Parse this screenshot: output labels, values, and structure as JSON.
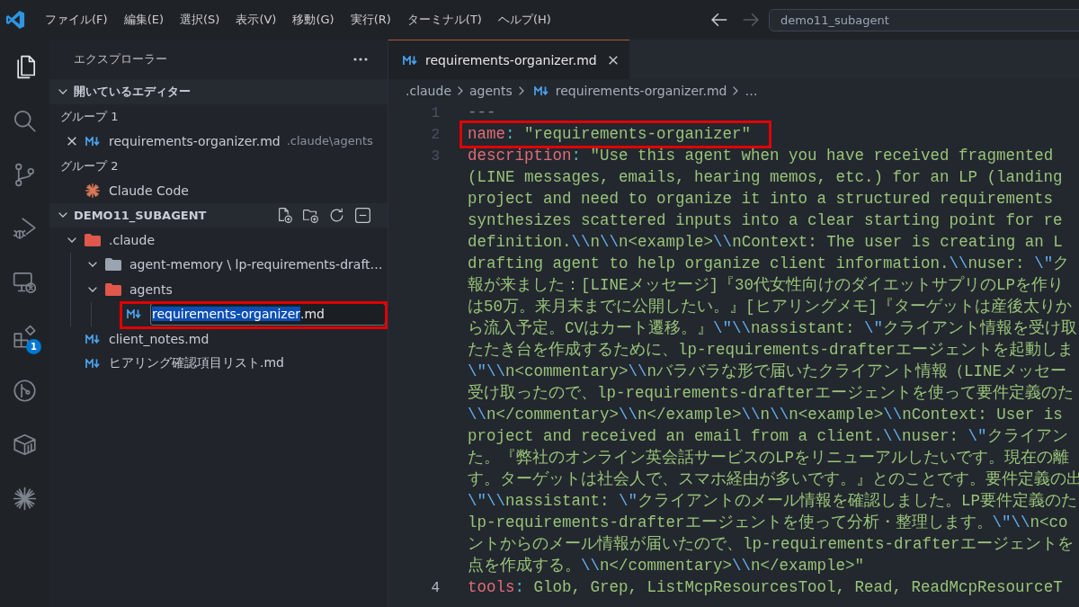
{
  "title_bar": {
    "menus": [
      "ファイル(F)",
      "編集(E)",
      "選択(S)",
      "表示(V)",
      "移動(G)",
      "実行(R)",
      "ターミナル(T)",
      "ヘルプ(H)"
    ],
    "nav": [
      {
        "kind": "back",
        "disabled": false
      },
      {
        "kind": "forward",
        "disabled": true
      }
    ],
    "command_center": {
      "label": "demo11_subagent"
    }
  },
  "activity_bar": [
    {
      "kind": "explorer",
      "selected": true
    },
    {
      "kind": "search",
      "selected": false
    },
    {
      "kind": "source_control",
      "selected": false
    },
    {
      "kind": "run_debug",
      "selected": false
    },
    {
      "kind": "remote",
      "selected": false
    },
    {
      "kind": "extensions",
      "selected": false,
      "badge": "1"
    },
    {
      "kind": "git_graph",
      "selected": false
    },
    {
      "kind": "containers",
      "selected": false
    },
    {
      "kind": "claude",
      "selected": false
    }
  ],
  "sidebar": {
    "title": "エクスプローラー",
    "open_editors": {
      "title": "開いているエディター",
      "expanded": true,
      "groups": [
        {
          "label": "グループ 1",
          "items": [
            {
              "kind": "markdown",
              "name": "requirements-organizer.md",
              "description": ".claude\\agents",
              "selected": true
            }
          ]
        },
        {
          "label": "グループ 2",
          "items": [
            {
              "kind": "claude",
              "name": "Claude Code",
              "selected": false
            }
          ]
        }
      ]
    },
    "workspace": {
      "title": "DEMO11_SUBAGENT",
      "expanded": true,
      "actions": [
        {
          "kind": "new_file"
        },
        {
          "kind": "new_folder"
        },
        {
          "kind": "refresh"
        },
        {
          "kind": "collapse_all"
        }
      ],
      "tree": [
        {
          "kind": "folder",
          "name": ".claude",
          "color": "#e0574b",
          "expanded": true,
          "highlighted": false,
          "children": [
            {
              "kind": "folder",
              "name": "agent-memory \\ lp-requirements-draft…",
              "color": "#9aa4b0",
              "expanded": true,
              "highlighted": false
            },
            {
              "kind": "folder",
              "name": "agents",
              "color": "#e0574b",
              "expanded": true,
              "highlighted": false,
              "children": [
                {
                  "kind": "markdown",
                  "name": "requirements-organizer",
                  "ext": ".md",
                  "editing": true,
                  "highlighted": true
                }
              ]
            }
          ]
        },
        {
          "kind": "markdown",
          "name": "client_notes",
          "ext": ".md",
          "editing": false,
          "highlighted": false
        },
        {
          "kind": "markdown",
          "name": "ヒアリング確認項目リスト",
          "ext": ".md",
          "editing": false,
          "highlighted": false
        }
      ]
    }
  },
  "editor": {
    "tabs": [
      {
        "label": "requirements-organizer.md",
        "selected": true
      }
    ],
    "breadcrumb": [
      {
        "kind": "folder",
        "label": ".claude"
      },
      {
        "kind": "folder",
        "label": "agents"
      },
      {
        "kind": "markdown",
        "label": "requirements-organizer.md"
      },
      {
        "kind": "outline",
        "label": "…"
      }
    ],
    "lines": [
      {
        "number": "1",
        "current": false,
        "highlighted": false,
        "rows": [
          {
            "tokens": [
              {
                "kind": "marker",
                "text": "---"
              }
            ]
          }
        ]
      },
      {
        "number": "2",
        "current": false,
        "highlighted": true,
        "rows": [
          {
            "tokens": [
              {
                "kind": "key",
                "text": "name"
              },
              {
                "kind": "colon",
                "text": ":"
              },
              {
                "kind": "string",
                "text": " \"requirements-organizer\""
              }
            ]
          }
        ]
      },
      {
        "number": "3",
        "current": false,
        "highlighted": false,
        "rows": [
          {
            "tokens": [
              {
                "kind": "key",
                "text": "description"
              },
              {
                "kind": "colon",
                "text": ":"
              },
              {
                "kind": "string",
                "text": " \"Use this agent when you have received fragmented"
              }
            ]
          },
          {
            "tokens": [
              {
                "kind": "string",
                "text": "(LINE messages, emails, hearing memos, etc.) for an LP (landing"
              }
            ]
          },
          {
            "tokens": [
              {
                "kind": "string",
                "text": "project and need to organize it into a structured requirements"
              }
            ]
          },
          {
            "tokens": [
              {
                "kind": "string",
                "text": "synthesizes scattered inputs into a clear starting point for re"
              }
            ]
          },
          {
            "tokens": [
              {
                "kind": "string",
                "text": "definition."
              },
              {
                "kind": "escape",
                "text": "\\\\"
              },
              {
                "kind": "string",
                "text": "n"
              },
              {
                "kind": "escape",
                "text": "\\\\"
              },
              {
                "kind": "string",
                "text": "n<example>"
              },
              {
                "kind": "escape",
                "text": "\\\\"
              },
              {
                "kind": "string",
                "text": "nContext: The user is creating an L"
              }
            ]
          },
          {
            "tokens": [
              {
                "kind": "string",
                "text": "drafting agent to help organize client information."
              },
              {
                "kind": "escape",
                "text": "\\\\"
              },
              {
                "kind": "string",
                "text": "nuser: "
              },
              {
                "kind": "escape",
                "text": "\\\""
              },
              {
                "kind": "string",
                "text": "ク"
              }
            ]
          },
          {
            "tokens": [
              {
                "kind": "string",
                "text": "報が来ました：[LINEメッセージ]『30代女性向けのダイエットサプリのLPを作り"
              }
            ]
          },
          {
            "tokens": [
              {
                "kind": "string",
                "text": "は50万。来月末までに公開したい。』[ヒアリングメモ]『ターゲットは産後太りか"
              }
            ]
          },
          {
            "tokens": [
              {
                "kind": "string",
                "text": "ら流入予定。CVはカート遷移。』"
              },
              {
                "kind": "escape",
                "text": "\\\""
              },
              {
                "kind": "escape",
                "text": "\\\\"
              },
              {
                "kind": "string",
                "text": "nassistant: "
              },
              {
                "kind": "escape",
                "text": "\\\""
              },
              {
                "kind": "string",
                "text": "クライアント情報を受け取"
              }
            ]
          },
          {
            "tokens": [
              {
                "kind": "string",
                "text": "たたき台を作成するために、lp-requirements-drafterエージェントを起動しま"
              }
            ]
          },
          {
            "tokens": [
              {
                "kind": "escape",
                "text": "\\\""
              },
              {
                "kind": "escape",
                "text": "\\\\"
              },
              {
                "kind": "string",
                "text": "n<commentary>"
              },
              {
                "kind": "escape",
                "text": "\\\\"
              },
              {
                "kind": "string",
                "text": "nバラバラな形で届いたクライアント情報（LINEメッセー"
              }
            ]
          },
          {
            "tokens": [
              {
                "kind": "string",
                "text": "受け取ったので、lp-requirements-drafterエージェントを使って要件定義のた"
              }
            ]
          },
          {
            "tokens": [
              {
                "kind": "escape",
                "text": "\\\\"
              },
              {
                "kind": "string",
                "text": "n</commentary>"
              },
              {
                "kind": "escape",
                "text": "\\\\"
              },
              {
                "kind": "string",
                "text": "n</example>"
              },
              {
                "kind": "escape",
                "text": "\\\\"
              },
              {
                "kind": "string",
                "text": "n"
              },
              {
                "kind": "escape",
                "text": "\\\\"
              },
              {
                "kind": "string",
                "text": "n<example>"
              },
              {
                "kind": "escape",
                "text": "\\\\"
              },
              {
                "kind": "string",
                "text": "nContext: User is"
              }
            ]
          },
          {
            "tokens": [
              {
                "kind": "string",
                "text": "project and received an email from a client."
              },
              {
                "kind": "escape",
                "text": "\\\\"
              },
              {
                "kind": "string",
                "text": "nuser: "
              },
              {
                "kind": "escape",
                "text": "\\\""
              },
              {
                "kind": "string",
                "text": "クライアン"
              }
            ]
          },
          {
            "tokens": [
              {
                "kind": "string",
                "text": "た。『弊社のオンライン英会話サービスのLPをリニューアルしたいです。現在の離"
              }
            ]
          },
          {
            "tokens": [
              {
                "kind": "string",
                "text": "す。ターゲットは社会人で、スマホ経由が多いです。』とのことです。要件定義の出"
              }
            ]
          },
          {
            "tokens": [
              {
                "kind": "escape",
                "text": "\\\""
              },
              {
                "kind": "escape",
                "text": "\\\\"
              },
              {
                "kind": "string",
                "text": "nassistant: "
              },
              {
                "kind": "escape",
                "text": "\\\""
              },
              {
                "kind": "string",
                "text": "クライアントのメール情報を確認しました。LP要件定義のた"
              }
            ]
          },
          {
            "tokens": [
              {
                "kind": "string",
                "text": "lp-requirements-drafterエージェントを使って分析・整理します。"
              },
              {
                "kind": "escape",
                "text": "\\\""
              },
              {
                "kind": "escape",
                "text": "\\\\"
              },
              {
                "kind": "string",
                "text": "n<co"
              }
            ]
          },
          {
            "tokens": [
              {
                "kind": "string",
                "text": "ントからのメール情報が届いたので、lp-requirements-drafterエージェントを"
              }
            ]
          },
          {
            "tokens": [
              {
                "kind": "string",
                "text": "点を作成する。"
              },
              {
                "kind": "escape",
                "text": "\\\\"
              },
              {
                "kind": "string",
                "text": "n</commentary>"
              },
              {
                "kind": "escape",
                "text": "\\\\"
              },
              {
                "kind": "string",
                "text": "n</example>\""
              }
            ]
          }
        ]
      },
      {
        "number": "4",
        "current": true,
        "highlighted": false,
        "rows": [
          {
            "tokens": [
              {
                "kind": "key",
                "text": "tools"
              },
              {
                "kind": "colon",
                "text": ":"
              },
              {
                "kind": "string",
                "text": " Glob, Grep, ListMcpResourcesTool, Read, ReadMcpResourceT"
              }
            ]
          }
        ]
      }
    ]
  }
}
